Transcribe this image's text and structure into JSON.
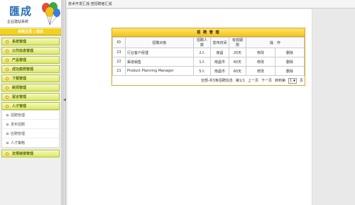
{
  "logo": {
    "title": "匯成",
    "subtitle": "企业建站系统"
  },
  "account": {
    "home": "系统主页",
    "sep": "|",
    "logout": "退出"
  },
  "menu": [
    {
      "label": "系统管理"
    },
    {
      "label": "公司信息管理"
    },
    {
      "label": "产品管理"
    },
    {
      "label": "成功案例管理"
    },
    {
      "label": "下载管理"
    },
    {
      "label": "新闻管理"
    },
    {
      "label": "留言管理"
    },
    {
      "label": "人才管理"
    },
    {
      "label": "友情链接管理"
    }
  ],
  "submenu": [
    "招聘管理",
    "发布招聘",
    "应聘管理",
    "人才策略"
  ],
  "topbar": {
    "text": "技术开发汇成-查招聘者汇成"
  },
  "panel": {
    "title": "招 聘 管 理"
  },
  "table": {
    "headers": [
      "ID",
      "招聘对象",
      "招聘人数",
      "发布时间",
      "有效期限",
      "操　作"
    ],
    "rows": [
      {
        "id": "23",
        "name": "行业客户经理",
        "count": "2人",
        "place": "南昌",
        "valid": "20天",
        "edit": "修改",
        "del": "删除"
      },
      {
        "id": "22",
        "name": "渠道销售",
        "count": "1人",
        "place": "南昌市",
        "valid": "60天",
        "edit": "修改",
        "del": "删除"
      },
      {
        "id": "21",
        "name": "Product Planning Manager",
        "count": "5人",
        "place": "南昌市",
        "valid": "60天",
        "edit": "修改",
        "del": "删除"
      }
    ]
  },
  "pager": {
    "summary": "全部-共3条招聘信息",
    "page": "第1/1",
    "prev": "上一页",
    "next": "下一页",
    "goto": "转到第",
    "current": "1",
    "suffix": "页"
  },
  "colors": {
    "menu_header": "#d9ea62",
    "account_bar": "#f3d21f",
    "panel_border": "#d5a82a",
    "logo_title": "#2a6fb6"
  }
}
